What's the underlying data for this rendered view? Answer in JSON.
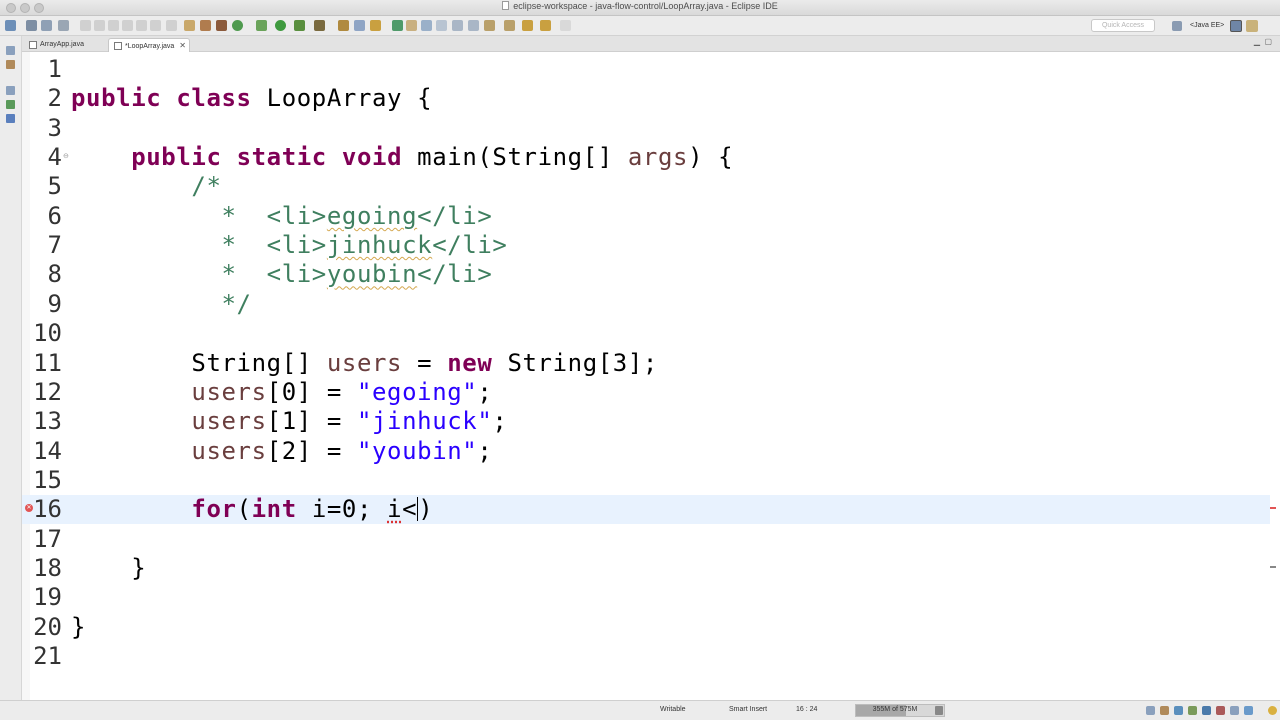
{
  "window": {
    "title": "eclipse-workspace - java-flow-control/LoopArray.java - Eclipse IDE"
  },
  "toolbar": {
    "quick_access_placeholder": "Quick Access",
    "perspective_label": "<Java EE>"
  },
  "tabs": [
    {
      "label": "ArrayApp.java",
      "active": false
    },
    {
      "label": "*LoopArray.java",
      "active": true
    }
  ],
  "editor": {
    "current_line": 16,
    "lines": [
      {
        "num": "1",
        "tokens": []
      },
      {
        "num": "2",
        "tokens": [
          [
            "kw",
            "public"
          ],
          [
            "",
            " "
          ],
          [
            "kw",
            "class"
          ],
          [
            "",
            " LoopArray {"
          ]
        ]
      },
      {
        "num": "3",
        "tokens": []
      },
      {
        "num": "4",
        "tokens": [
          [
            "",
            "    "
          ],
          [
            "kw",
            "public"
          ],
          [
            "",
            " "
          ],
          [
            "kw",
            "static"
          ],
          [
            "",
            " "
          ],
          [
            "kw",
            "void"
          ],
          [
            "",
            " main(String[] "
          ],
          [
            "var",
            "args"
          ],
          [
            "",
            ") {"
          ]
        ]
      },
      {
        "num": "5",
        "tokens": [
          [
            "",
            "        "
          ],
          [
            "cm",
            "/*"
          ]
        ]
      },
      {
        "num": "6",
        "tokens": [
          [
            "",
            "         "
          ],
          [
            "cm",
            " *  <li>"
          ],
          [
            "cm sq",
            "egoing"
          ],
          [
            "cm",
            "</li>"
          ]
        ]
      },
      {
        "num": "7",
        "tokens": [
          [
            "",
            "         "
          ],
          [
            "cm",
            " *  <li>"
          ],
          [
            "cm sq",
            "jinhuck"
          ],
          [
            "cm",
            "</li>"
          ]
        ]
      },
      {
        "num": "8",
        "tokens": [
          [
            "",
            "         "
          ],
          [
            "cm",
            " *  <li>"
          ],
          [
            "cm sq",
            "youbin"
          ],
          [
            "cm",
            "</li>"
          ]
        ]
      },
      {
        "num": "9",
        "tokens": [
          [
            "",
            "         "
          ],
          [
            "cm",
            " */"
          ]
        ]
      },
      {
        "num": "10",
        "tokens": []
      },
      {
        "num": "11",
        "tokens": [
          [
            "",
            "        String[] "
          ],
          [
            "var",
            "users"
          ],
          [
            "",
            " = "
          ],
          [
            "kw",
            "new"
          ],
          [
            "",
            " String[3];"
          ]
        ]
      },
      {
        "num": "12",
        "tokens": [
          [
            "",
            "        "
          ],
          [
            "var",
            "users"
          ],
          [
            "",
            "[0] = "
          ],
          [
            "str",
            "\"egoing\""
          ],
          [
            "",
            ";"
          ]
        ]
      },
      {
        "num": "13",
        "tokens": [
          [
            "",
            "        "
          ],
          [
            "var",
            "users"
          ],
          [
            "",
            "[1] = "
          ],
          [
            "str",
            "\"jinhuck\""
          ],
          [
            "",
            ";"
          ]
        ]
      },
      {
        "num": "14",
        "tokens": [
          [
            "",
            "        "
          ],
          [
            "var",
            "users"
          ],
          [
            "",
            "[2] = "
          ],
          [
            "str",
            "\"youbin\""
          ],
          [
            "",
            ";"
          ]
        ]
      },
      {
        "num": "15",
        "tokens": []
      },
      {
        "num": "16",
        "tokens": [
          [
            "",
            "        "
          ],
          [
            "kw",
            "for"
          ],
          [
            "",
            "("
          ],
          [
            "kw",
            "int"
          ],
          [
            "",
            " i=0; "
          ],
          [
            "err",
            "i"
          ],
          [
            "",
            "<"
          ],
          [
            "caret",
            ""
          ],
          [
            "",
            ")"
          ]
        ]
      },
      {
        "num": "17",
        "tokens": []
      },
      {
        "num": "18",
        "tokens": [
          [
            "",
            "    }"
          ]
        ]
      },
      {
        "num": "19",
        "tokens": []
      },
      {
        "num": "20",
        "tokens": [
          [
            "",
            "}"
          ]
        ]
      },
      {
        "num": "21",
        "tokens": []
      }
    ]
  },
  "statusbar": {
    "writable": "Writable",
    "insert_mode": "Smart Insert",
    "position": "16 : 24",
    "heap": "355M of 575M",
    "heap_used_fraction": 0.62
  },
  "colors": {
    "keyword": "#7f0055",
    "comment": "#3f7f5f",
    "string": "#2a00ff",
    "variable": "#6a3e3e",
    "current_line": "#e8f2fe"
  }
}
